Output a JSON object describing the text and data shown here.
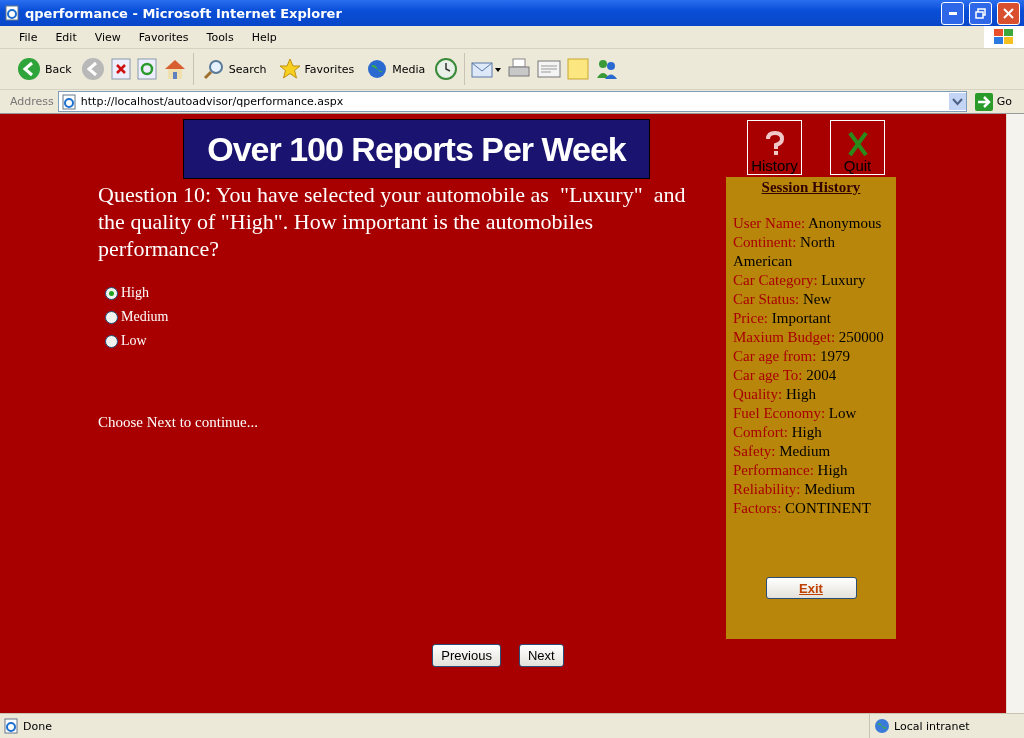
{
  "window": {
    "title": "qperformance - Microsoft Internet Explorer"
  },
  "menu": [
    "File",
    "Edit",
    "View",
    "Favorites",
    "Tools",
    "Help"
  ],
  "toolbar": [
    "Back",
    "Search",
    "Favorites",
    "Media"
  ],
  "address": {
    "label": "Address",
    "url": "http://localhost/autoadvisor/qperformance.aspx",
    "go": "Go"
  },
  "banner": "Over 100 Reports Per Week",
  "question": "Question 10: You have selected your automobile as  \"Luxury\"  and the quality of \"High\". How important is the automobiles performance?",
  "options": [
    {
      "label": "High",
      "selected": true
    },
    {
      "label": "Medium",
      "selected": false
    },
    {
      "label": "Low",
      "selected": false
    }
  ],
  "hint": "Choose Next to continue...",
  "top_buttons": [
    "History",
    "Quit"
  ],
  "session": {
    "title": "Session History",
    "items": [
      {
        "label": "User Name:",
        "value": "Anonymous"
      },
      {
        "label": "Continent:",
        "value": "North American"
      },
      {
        "label": "Car Category:",
        "value": "Luxury"
      },
      {
        "label": "Car Status:",
        "value": "New"
      },
      {
        "label": "Price:",
        "value": "Important"
      },
      {
        "label": "Maxium Budget:",
        "value": "250000"
      },
      {
        "label": "Car age from:",
        "value": "1979"
      },
      {
        "label": "Car age To:",
        "value": "2004"
      },
      {
        "label": "Quality:",
        "value": "High"
      },
      {
        "label": "Fuel Economy:",
        "value": "Low"
      },
      {
        "label": "Comfort:",
        "value": "High"
      },
      {
        "label": "Safety:",
        "value": "Medium"
      },
      {
        "label": "Performance:",
        "value": "High"
      },
      {
        "label": "Reliability:",
        "value": "Medium"
      },
      {
        "label": "Factors:",
        "value": "CONTINENT"
      }
    ],
    "exit": "Exit"
  },
  "nav": [
    "Previous",
    "Next"
  ],
  "status": {
    "text": "Done",
    "zone": "Local intranet"
  }
}
